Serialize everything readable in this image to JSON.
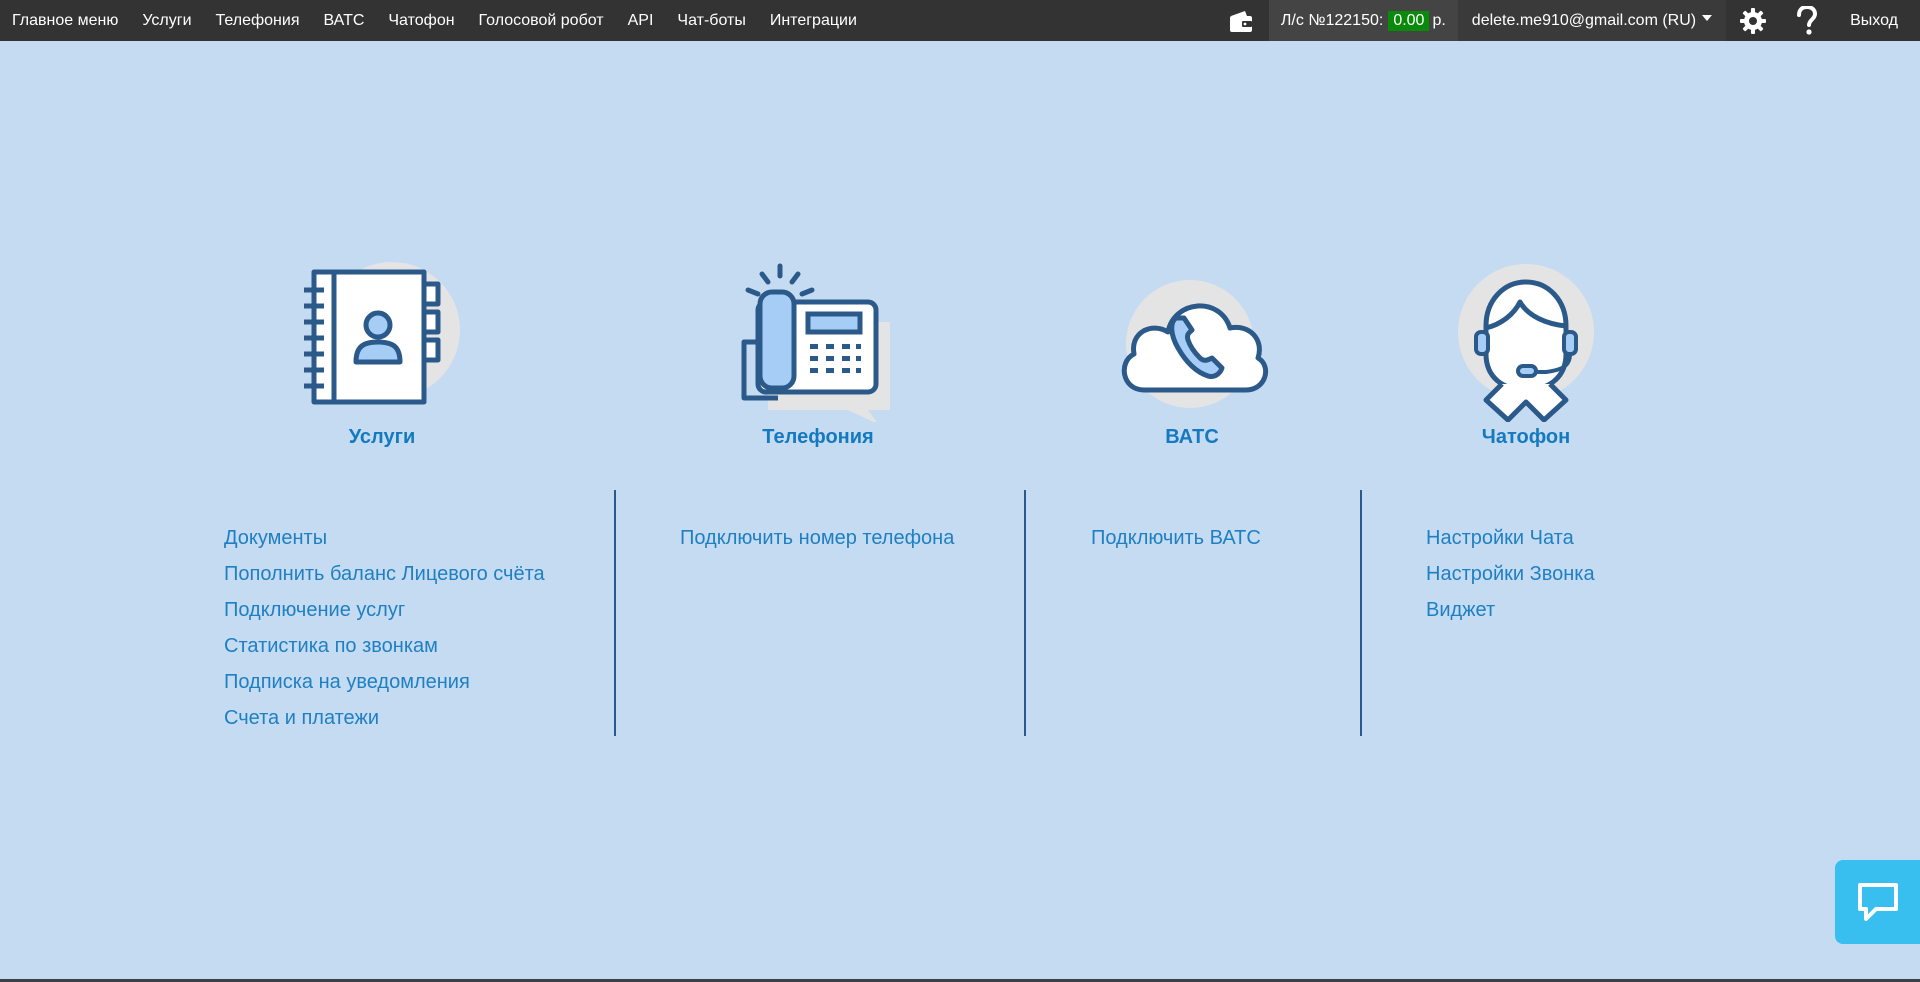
{
  "nav": {
    "items": [
      "Главное меню",
      "Услуги",
      "Телефония",
      "ВАТС",
      "Чатофон",
      "Голосовой робот",
      "API",
      "Чат-боты",
      "Интеграции"
    ],
    "account_label": "Л/с №122150:",
    "balance": "0.00",
    "currency": "р.",
    "user": "delete.me910@gmail.com (RU)",
    "logout": "Выход"
  },
  "categories": [
    {
      "title": "Услуги",
      "links": [
        "Документы",
        "Пополнить баланс Лицевого счёта",
        "Подключение услуг",
        "Статистика по звонкам",
        "Подписка на уведомления",
        "Счета и платежи"
      ]
    },
    {
      "title": "Телефония",
      "links": [
        "Подключить номер телефона"
      ]
    },
    {
      "title": "ВАТС",
      "links": [
        "Подключить ВАТС"
      ]
    },
    {
      "title": "Чатофон",
      "links": [
        "Настройки Чата",
        "Настройки Звонка",
        "Виджет"
      ]
    }
  ],
  "icons": {
    "wallet": "wallet-icon",
    "settings": "gear-icon",
    "help": "question-icon",
    "chat": "chat-bubble-icon"
  },
  "colors": {
    "background": "#c5dbf2",
    "nav": "#333333",
    "link": "#1f7fc3",
    "title": "#1579c0",
    "balance": "#0a8a0a",
    "chat_button": "#38bff0"
  }
}
